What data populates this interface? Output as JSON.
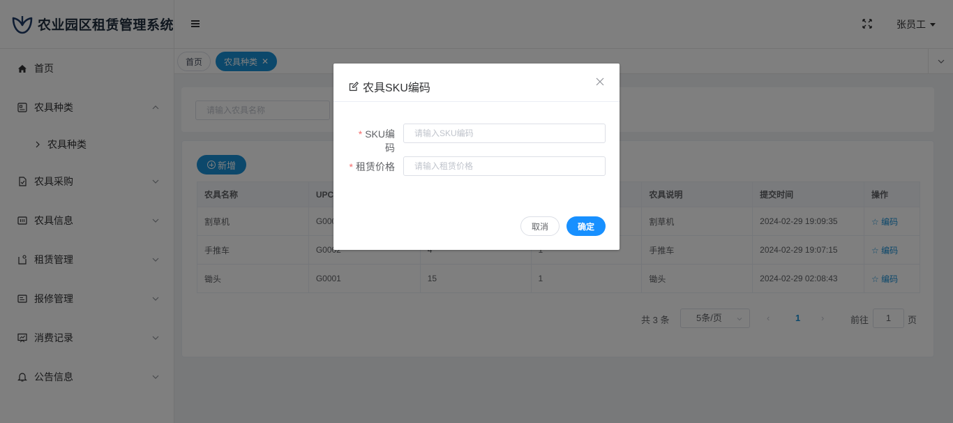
{
  "app": {
    "title": "农业园区租赁管理系统",
    "brand_color": "#1f3a66",
    "accent": "#1890d6"
  },
  "sidebar": {
    "items": [
      {
        "label": "首页",
        "icon": "home-icon"
      },
      {
        "label": "农具种类",
        "icon": "tool-category-icon",
        "expanded": true
      },
      {
        "label": "农具种类",
        "icon": "chevron-right-icon",
        "sub": true
      },
      {
        "label": "农具采购",
        "icon": "purchase-icon"
      },
      {
        "label": "农具信息",
        "icon": "info-icon"
      },
      {
        "label": "租赁管理",
        "icon": "rental-icon"
      },
      {
        "label": "报修管理",
        "icon": "repair-icon"
      },
      {
        "label": "消费记录",
        "icon": "consumption-icon"
      },
      {
        "label": "公告信息",
        "icon": "bell-icon"
      }
    ]
  },
  "header": {
    "user_name": "张员工"
  },
  "tabs": [
    {
      "label": "首页"
    },
    {
      "label": "农具种类",
      "active": true,
      "close": "✕"
    }
  ],
  "search": {
    "placeholder": "请输入农具名称"
  },
  "toolbar": {
    "add_label": "新增"
  },
  "table": {
    "columns": [
      "农具名称",
      "UPC",
      "",
      "",
      "农具说明",
      "提交时间",
      "操作"
    ],
    "rows": [
      [
        "割草机",
        "G0003",
        "",
        "",
        "割草机",
        "2024-02-29 19:09:35",
        "编码"
      ],
      [
        "手推车",
        "G0002",
        "4",
        "1",
        "手推车",
        "2024-02-29 19:07:15",
        "编码"
      ],
      [
        "锄头",
        "G0001",
        "15",
        "1",
        "锄头",
        "2024-02-29 02:08:43",
        "编码"
      ]
    ]
  },
  "pagination": {
    "total": "共 3 条",
    "page_size": "5条/页",
    "current": "1",
    "goto_label": "前往",
    "goto_value": "1",
    "goto_suffix": "页"
  },
  "dialog": {
    "title": "农具SKU编码",
    "fields": [
      {
        "label": "SKU编码",
        "placeholder": "请输入SKU编码",
        "required": "*"
      },
      {
        "label": "租赁价格",
        "placeholder": "请输入租赁价格",
        "required": "*"
      }
    ],
    "cancel_label": "取消",
    "ok_label": "确定"
  }
}
